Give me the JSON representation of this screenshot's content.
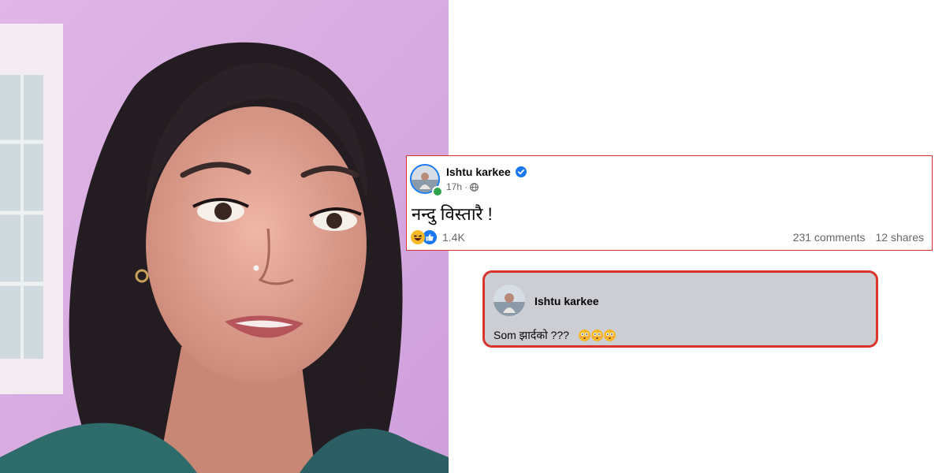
{
  "post": {
    "author": "Ishtu karkee",
    "time": "17h",
    "separator": "·",
    "text": "नन्दु विस्तारै !",
    "reaction_count": "1.4K",
    "comments": "231 comments",
    "shares": "12 shares",
    "icons": [
      "verified-badge-icon",
      "globe-icon",
      "haha-reaction-icon",
      "like-reaction-icon"
    ]
  },
  "comment": {
    "author": "Ishtu karkee",
    "text": "Som झार्दको  ???",
    "emoji_count": 3,
    "emoji_icon": "flushed-face-icon"
  },
  "colors": {
    "highlight_border": "#d9342b",
    "facebook_blue": "#1877f2",
    "online_green": "#31a24c",
    "comment_bg": "#ccced3",
    "meta_gray": "#65676b"
  }
}
